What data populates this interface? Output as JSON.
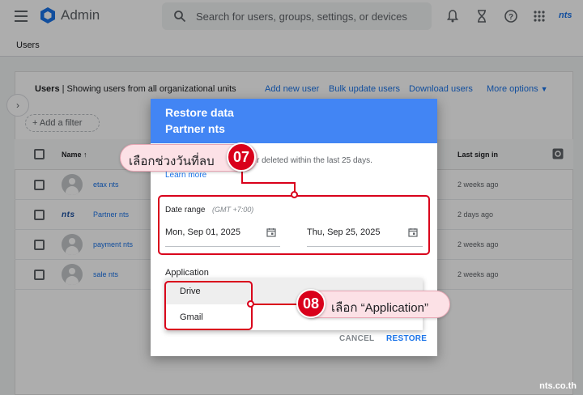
{
  "topbar": {
    "app_title": "Admin",
    "search_placeholder": "Search for users, groups, settings, or devices",
    "brand_small": "nts"
  },
  "breadcrumb": "Users",
  "users_card": {
    "title_bold": "Users",
    "title_rest": " | Showing users from all organizational units",
    "links": [
      "Add new user",
      "Bulk update users",
      "Download users",
      "More options"
    ],
    "filter_label": "Add a filter",
    "columns": {
      "name": "Name",
      "last_sign_in": "Last sign in"
    },
    "rows": [
      {
        "name": "etax nts",
        "last_sign_in": "2 weeks ago",
        "avatar": "person-avatar"
      },
      {
        "name": "Partner nts",
        "last_sign_in": "2 days ago",
        "avatar": "nts-logo",
        "logo_text": "nts"
      },
      {
        "name": "payment nts",
        "last_sign_in": "2 weeks ago",
        "avatar": "person-avatar"
      },
      {
        "name": "sale nts",
        "last_sign_in": "2 weeks ago",
        "avatar": "person-avatar"
      }
    ]
  },
  "dialog": {
    "title": "Restore data",
    "subtitle": "Partner nts",
    "description": "r deleted within the last 25 days.",
    "learn_more": "Learn more",
    "date_range_label": "Date range",
    "timezone": "(GMT +7:00)",
    "start_date": "Mon, Sep 01, 2025",
    "end_date": "Thu, Sep 25, 2025",
    "application_label": "Application",
    "application_options": [
      "Drive",
      "Gmail"
    ],
    "selected_option": "Drive",
    "cancel_label": "CANCEL",
    "restore_label": "RESTORE"
  },
  "annotations": {
    "step7": {
      "number": "07",
      "text": "เลือกช่วงวันที่ลบ"
    },
    "step8": {
      "number": "08",
      "text": "เลือก “Application”"
    },
    "highlight_color": "#d9001b",
    "callout_color": "#fce1e6"
  },
  "watermark": "nts.co.th",
  "colors": {
    "accent": "#1a73e8",
    "dialog_header": "#4285f4"
  }
}
